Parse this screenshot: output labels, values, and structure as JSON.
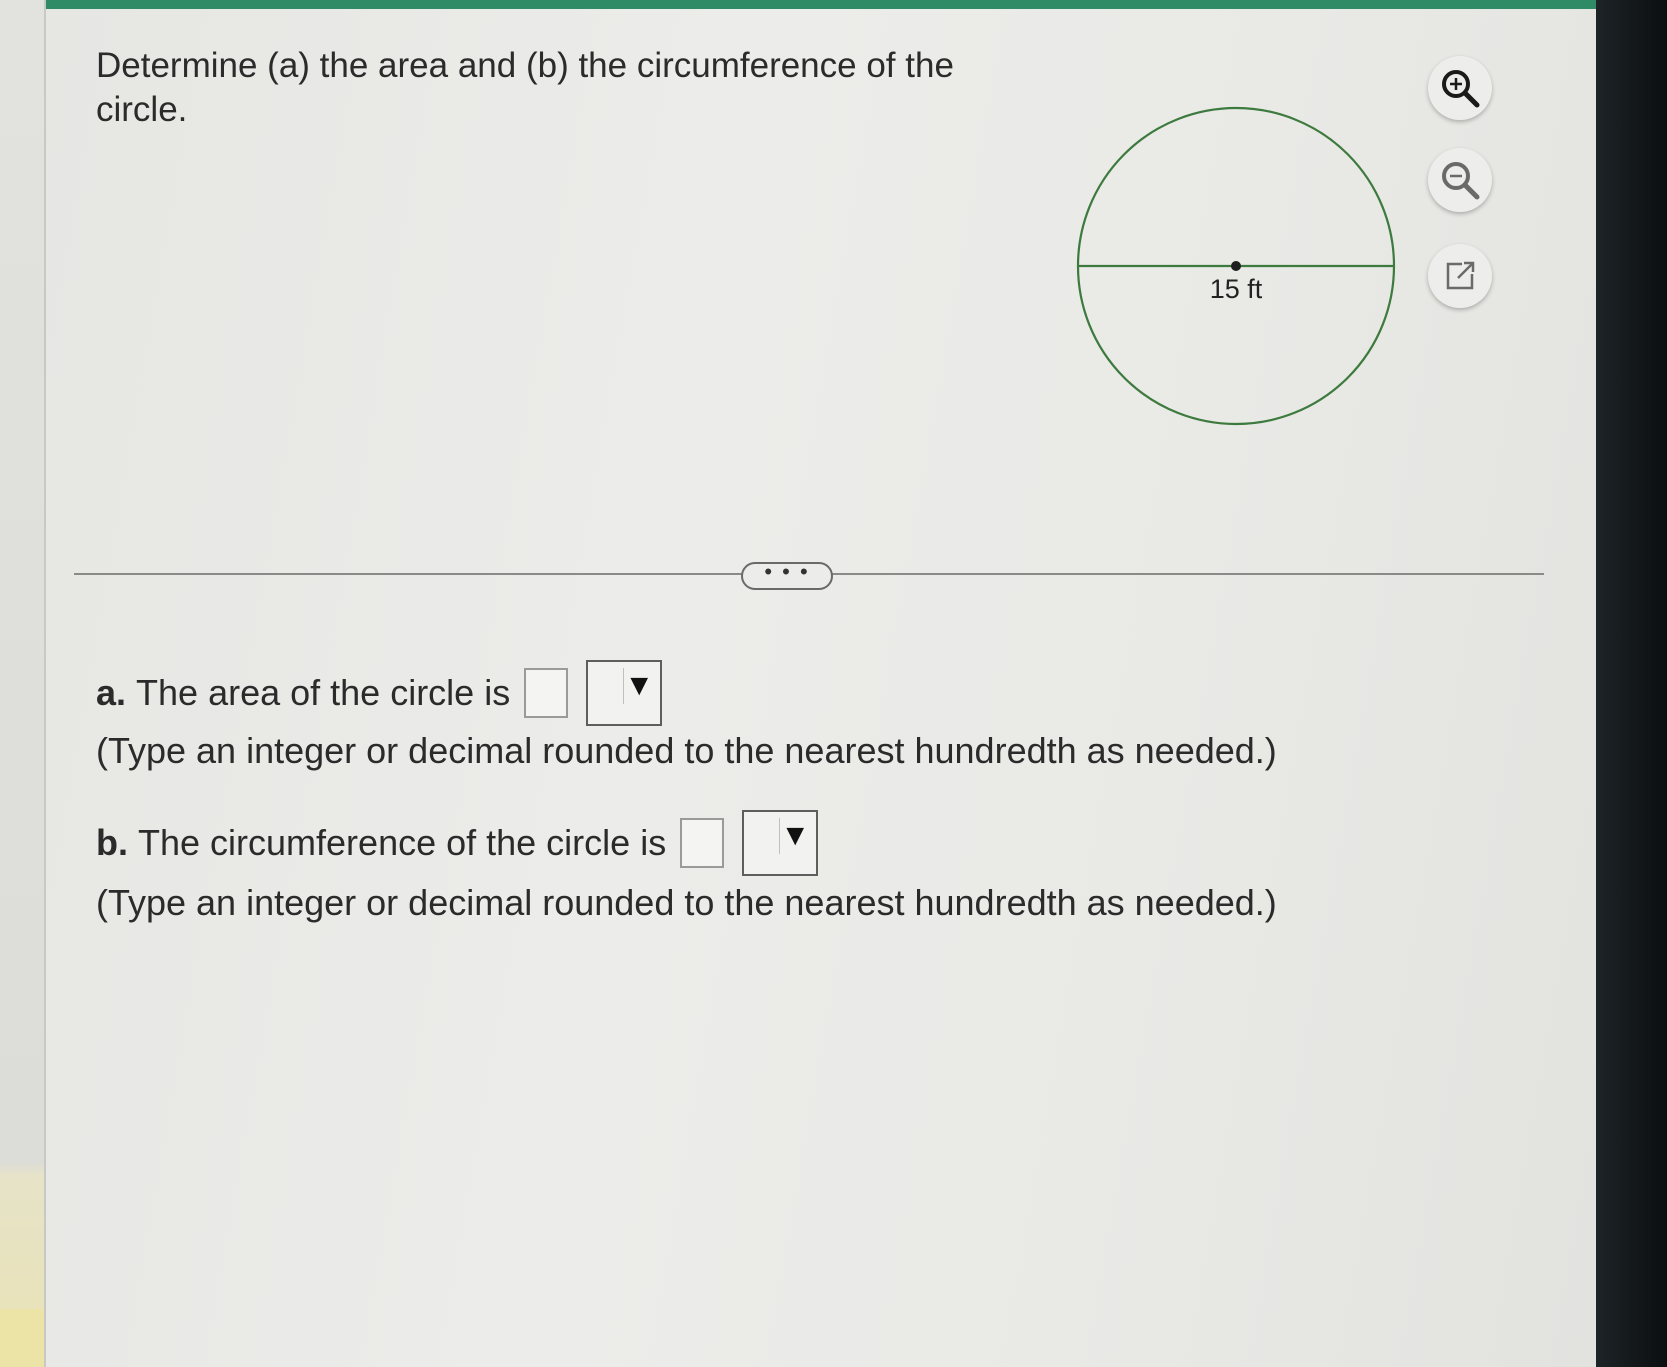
{
  "question": {
    "text": "Determine (a) the area and (b) the circumference of the circle."
  },
  "figure": {
    "diameter_label": "15 ft"
  },
  "tools": {
    "zoom_in": "zoom-in-icon",
    "zoom_out": "zoom-out-icon",
    "popout": "popout-icon"
  },
  "more_button": {
    "label": "• • •"
  },
  "part_a": {
    "letter": "a.",
    "text": "The area of the circle is",
    "input_value": "",
    "select_value": "",
    "arrow": "▼",
    "hint": "(Type an integer or decimal rounded to the nearest hundredth as needed.)"
  },
  "part_b": {
    "letter": "b.",
    "text": "The circumference of the circle is",
    "input_value": "",
    "select_value": "",
    "arrow": "▼",
    "hint": "(Type an integer or decimal rounded to the nearest hundredth as needed.)"
  },
  "colors": {
    "top_bar": "#2f8a66",
    "circle_stroke": "#3d7a3d"
  }
}
